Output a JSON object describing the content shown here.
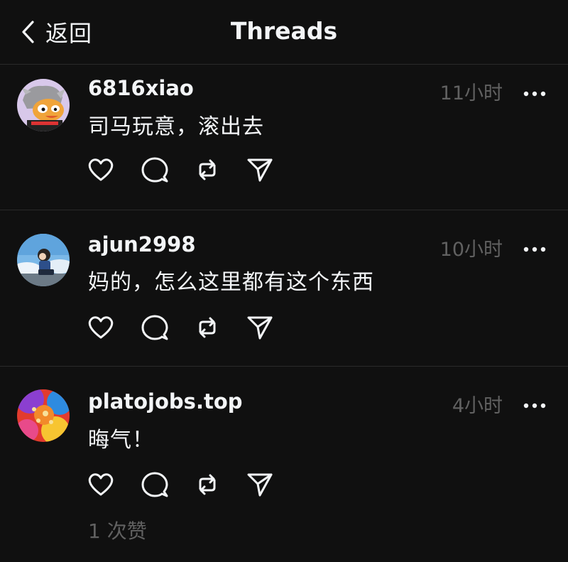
{
  "header": {
    "back_label": "返回",
    "title": "Threads"
  },
  "posts": [
    {
      "username": "6816xiao",
      "time": "11小时",
      "content": "司马玩意，滚出去"
    },
    {
      "username": "ajun2998",
      "time": "10小时",
      "content": "妈的，怎么这里都有这个东西"
    },
    {
      "username": "platojobs.top",
      "time": "4小时",
      "content": "晦气！",
      "likes": "1 次赞"
    }
  ],
  "icons": {
    "back": "chevron-left-icon",
    "more": "more-horizontal-icon",
    "like": "heart-icon",
    "reply": "comment-icon",
    "repost": "repost-icon",
    "share": "send-icon"
  },
  "colors": {
    "background": "#101010",
    "text": "#f3f5f7",
    "secondary": "#616161",
    "divider": "#2a2a2a"
  }
}
